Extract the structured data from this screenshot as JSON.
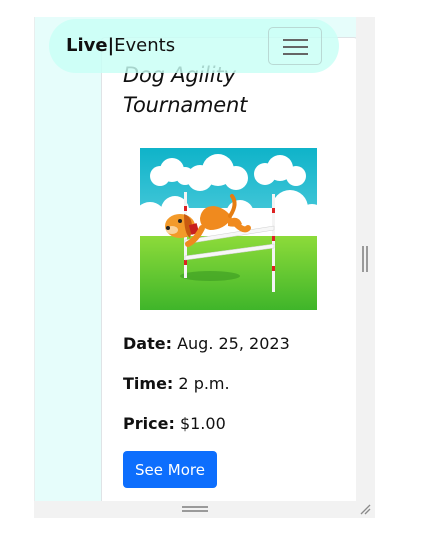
{
  "navbar": {
    "brand_bold": "Live|",
    "brand_rest": "Events",
    "menu_icon": "hamburger-icon"
  },
  "event": {
    "title": "Dog Agility Tournament",
    "image_subject": "cartoon dog jumping agility hurdle",
    "date_label": "Date:",
    "date_value": "Aug. 25, 2023",
    "time_label": "Time:",
    "time_value": "2 p.m.",
    "price_label": "Price:",
    "price_value": "$1.00",
    "button_label": "See More"
  },
  "colors": {
    "page_bg": "#e6fdfb",
    "navbar_bg": "#c8fff5",
    "button_bg": "#0d6efd",
    "card_bg": "#ffffff"
  }
}
